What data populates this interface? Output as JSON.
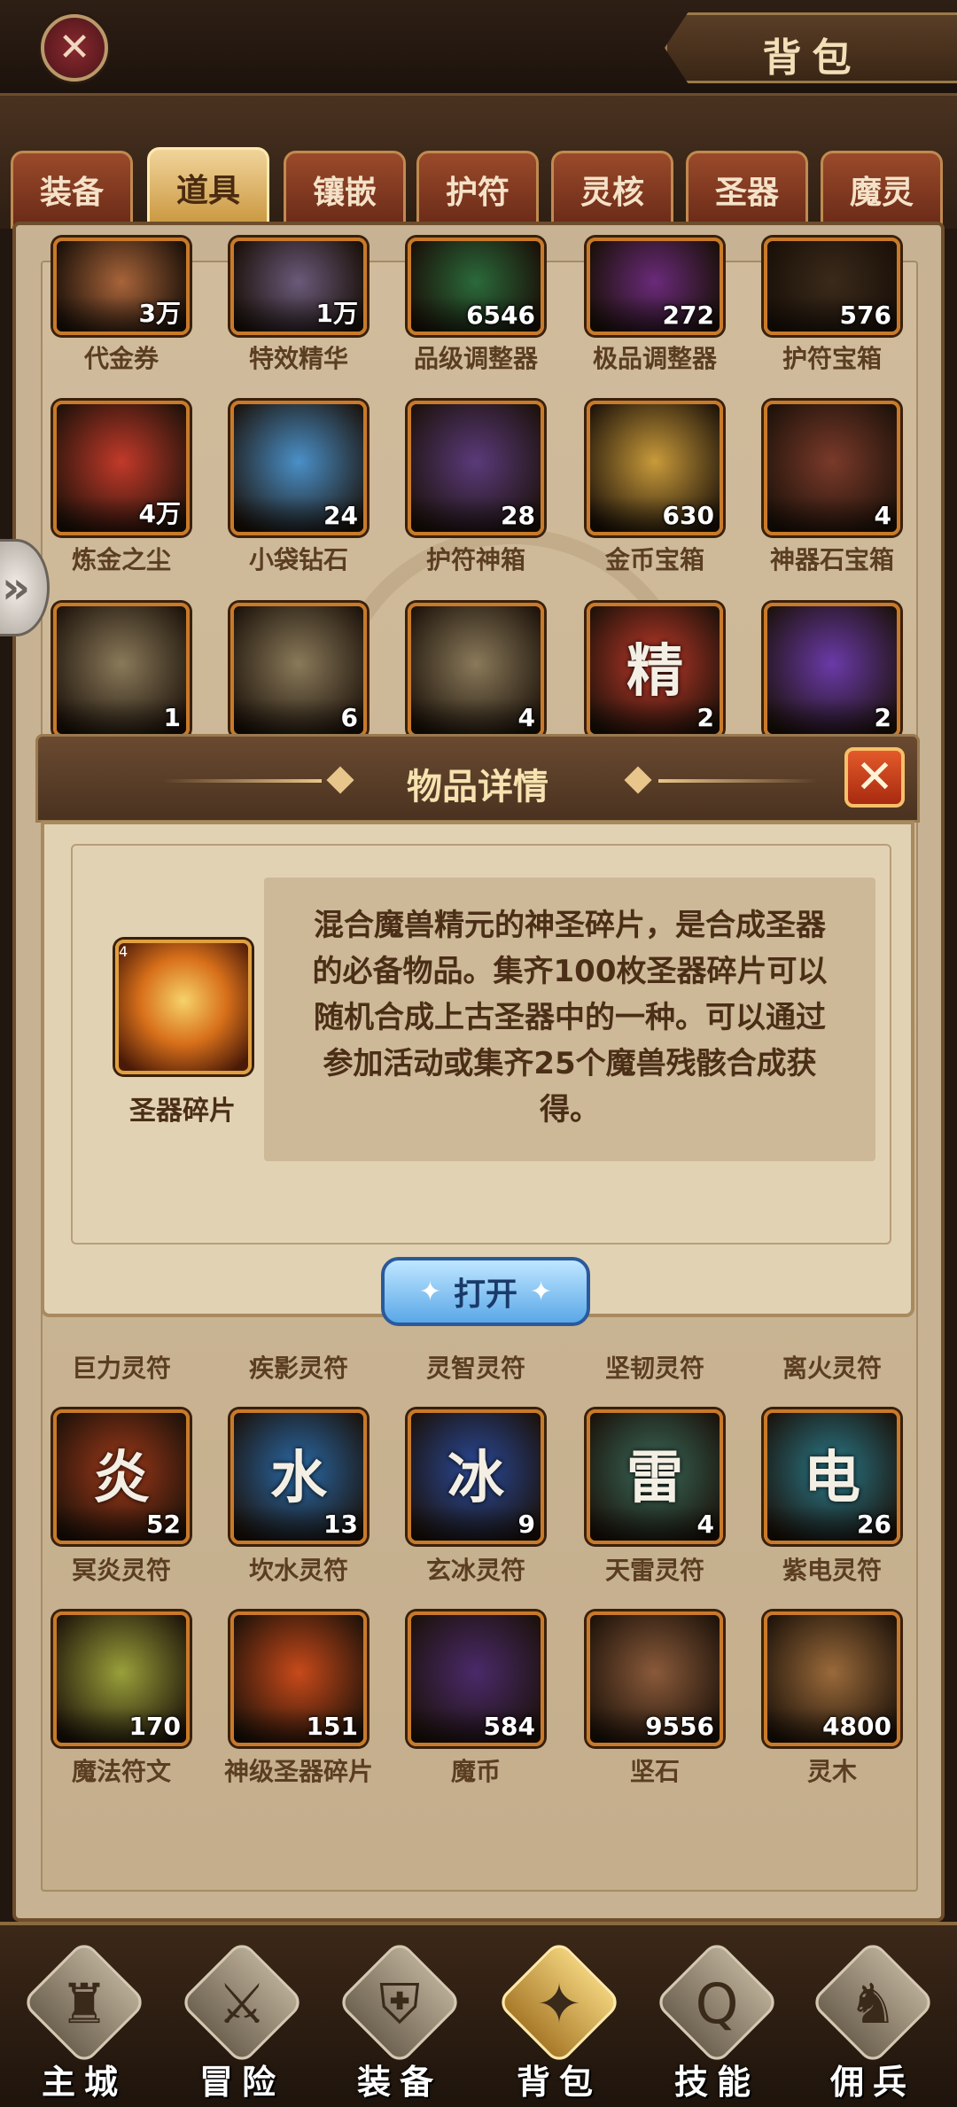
{
  "header": {
    "title": "背包",
    "close_symbol": "✕"
  },
  "tabs": [
    {
      "label": "装备",
      "active": false
    },
    {
      "label": "道具",
      "active": true
    },
    {
      "label": "镶嵌",
      "active": false
    },
    {
      "label": "护符",
      "active": false
    },
    {
      "label": "灵核",
      "active": false
    },
    {
      "label": "圣器",
      "active": false
    },
    {
      "label": "魔灵",
      "active": false
    }
  ],
  "side_toggle": "»",
  "rows": {
    "r1": [
      {
        "label": "代金券",
        "count": "3万",
        "color": "#a8643a"
      },
      {
        "label": "特效精华",
        "count": "1万",
        "color": "#6a5a7a"
      },
      {
        "label": "品级调整器",
        "count": "6546",
        "color": "#2a6a3a"
      },
      {
        "label": "极品调整器",
        "count": "272",
        "color": "#6a2a7a"
      },
      {
        "label": "护符宝箱",
        "count": "576",
        "color": "#3a2a1a"
      }
    ],
    "r2": [
      {
        "label": "炼金之尘",
        "count": "4万",
        "color": "#c23a2a"
      },
      {
        "label": "小袋钻石",
        "count": "24",
        "color": "#4a90c8"
      },
      {
        "label": "护符神箱",
        "count": "28",
        "color": "#5a3a7a"
      },
      {
        "label": "金币宝箱",
        "count": "630",
        "color": "#c89a3a"
      },
      {
        "label": "神器石宝箱",
        "count": "4",
        "color": "#7a3a2a"
      }
    ],
    "r3": [
      {
        "label": "",
        "count": "1",
        "color": "#8a7a5a"
      },
      {
        "label": "",
        "count": "6",
        "color": "#8a7a5a"
      },
      {
        "label": "",
        "count": "4",
        "color": "#8a7a5a"
      },
      {
        "label": "",
        "count": "2",
        "color": "#c03a2a",
        "glyph": "精"
      },
      {
        "label": "",
        "count": "2",
        "color": "#6a3aa8"
      }
    ],
    "r4": [
      {
        "label": "巨力灵符"
      },
      {
        "label": "疾影灵符"
      },
      {
        "label": "灵智灵符"
      },
      {
        "label": "坚韧灵符"
      },
      {
        "label": "离火灵符"
      }
    ],
    "r5": [
      {
        "label": "冥炎灵符",
        "count": "52",
        "color": "#a03a1a",
        "glyph": "炎"
      },
      {
        "label": "坎水灵符",
        "count": "13",
        "color": "#2a6aa8",
        "glyph": "水"
      },
      {
        "label": "玄冰灵符",
        "count": "9",
        "color": "#2a4a9a",
        "glyph": "冰"
      },
      {
        "label": "天雷灵符",
        "count": "4",
        "color": "#3a6a5a",
        "glyph": "雷"
      },
      {
        "label": "紫电灵符",
        "count": "26",
        "color": "#2a7a8a",
        "glyph": "电"
      }
    ],
    "r6": [
      {
        "label": "魔法符文",
        "count": "170",
        "color": "#9aa03a"
      },
      {
        "label": "神级圣器碎片",
        "count": "151",
        "color": "#c84a1a"
      },
      {
        "label": "魔币",
        "count": "584",
        "color": "#4a2a6a"
      },
      {
        "label": "坚石",
        "count": "9556",
        "color": "#8a5a3a"
      },
      {
        "label": "灵木",
        "count": "4800",
        "color": "#9a6a3a"
      }
    ]
  },
  "modal": {
    "title": "物品详情",
    "close_symbol": "✕",
    "item_name": "圣器碎片",
    "item_count": "4",
    "item_color": "#d8701a",
    "description": "混合魔兽精元的神圣碎片，是合成圣器的必备物品。集齐100枚圣器碎片可以随机合成上古圣器中的一种。可以通过参加活动或集齐25个魔兽残骸合成获得。",
    "open_label": "打开"
  },
  "bottom_nav": [
    {
      "label": "主城",
      "glyph": "♜",
      "active": false
    },
    {
      "label": "冒险",
      "glyph": "⚔",
      "active": false
    },
    {
      "label": "装备",
      "glyph": "⛨",
      "active": false
    },
    {
      "label": "背包",
      "glyph": "✦",
      "active": true
    },
    {
      "label": "技能",
      "glyph": "Q",
      "active": false
    },
    {
      "label": "佣兵",
      "glyph": "♞",
      "active": false
    }
  ]
}
